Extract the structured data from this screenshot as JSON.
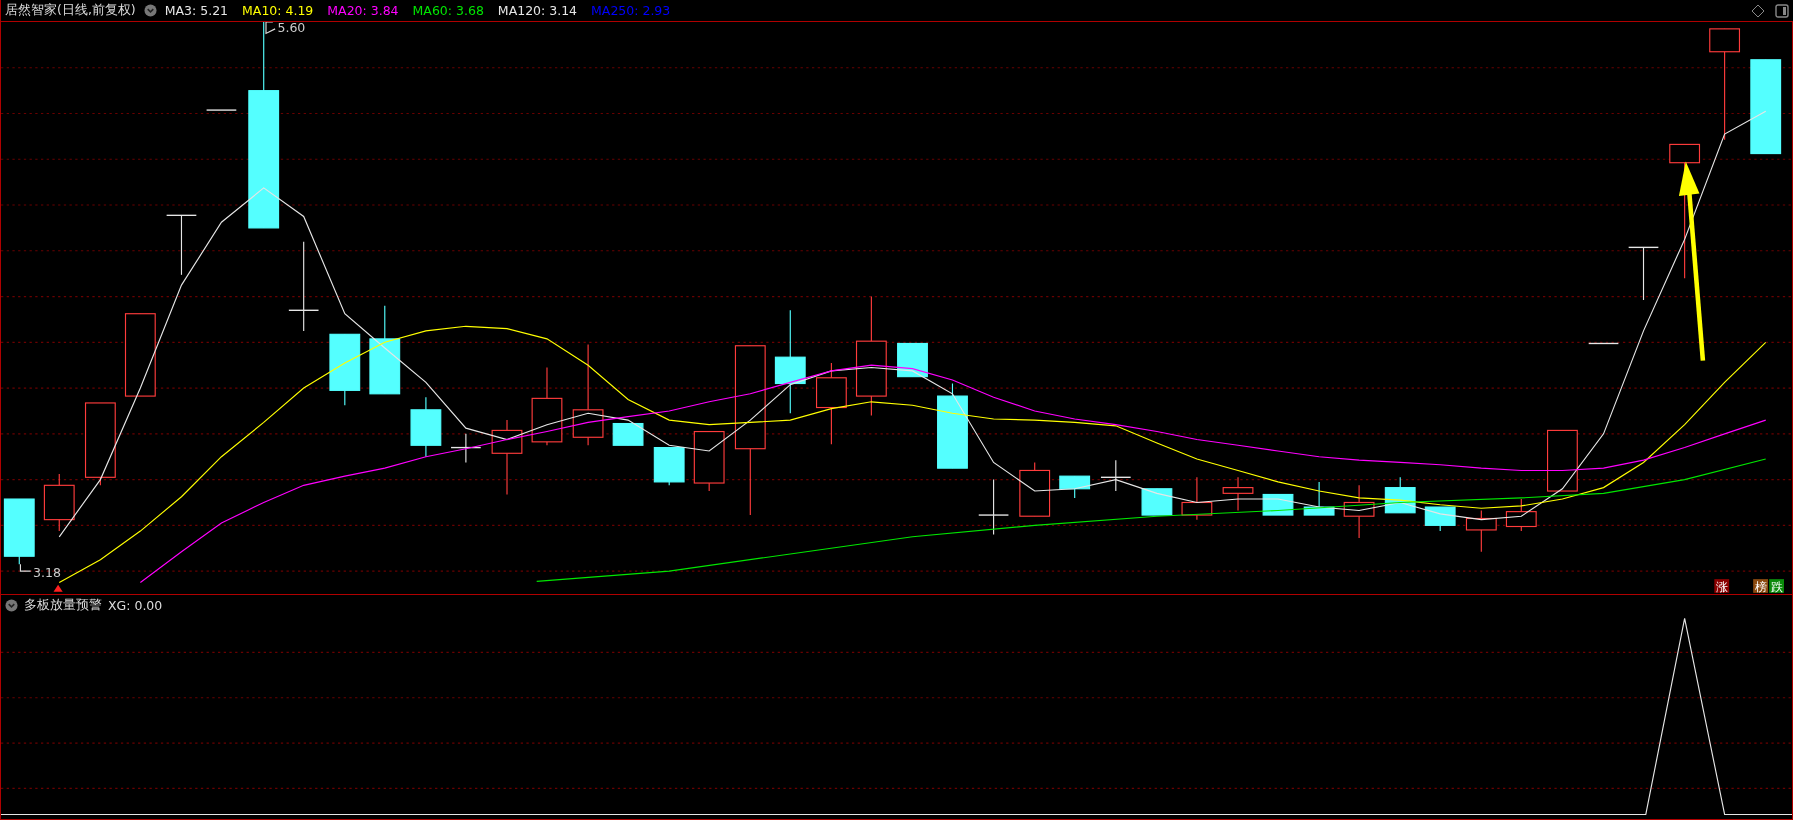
{
  "header": {
    "title": "居然智家(日线,前复权)"
  },
  "ma_legend": [
    {
      "label": "MA3: 5.21",
      "color": "#e6e6e6"
    },
    {
      "label": "MA10: 4.19",
      "color": "#ffff00"
    },
    {
      "label": "MA20: 3.84",
      "color": "#ff00ff"
    },
    {
      "label": "MA60: 3.68",
      "color": "#00e600"
    },
    {
      "label": "MA120: 3.14",
      "color": "#e6e6e6"
    },
    {
      "label": "MA250: 2.93",
      "color": "#0000ff"
    }
  ],
  "price_labels": {
    "high": "5.60",
    "low": "3.18"
  },
  "tags": [
    {
      "label": "涨",
      "color": "#8b0000"
    },
    {
      "label": "榜",
      "color": "#8b4a10"
    },
    {
      "label": "跌",
      "color": "#0a8a0a"
    }
  ],
  "indicator_panel": {
    "title": "多板放量预警",
    "reading": "XG: 0.00"
  }
}
